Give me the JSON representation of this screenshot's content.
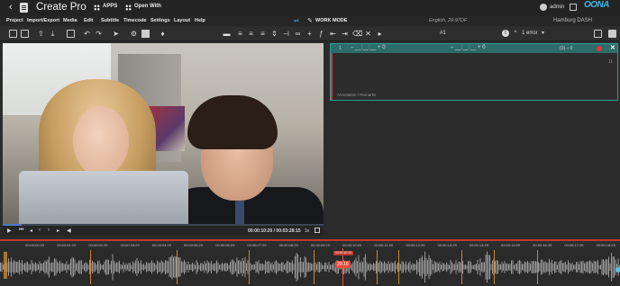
{
  "header": {
    "back_glyph": "‹",
    "title": "Create Pro",
    "apps_label": "APPS",
    "open_with_label": "Open With",
    "user_label": "admin",
    "logo": "OONA"
  },
  "menu": {
    "items": [
      "Project",
      "Import/Export",
      "Media",
      "Edit",
      "Subtitle",
      "Timecode",
      "Settings",
      "Layout",
      "Help"
    ],
    "work_mode": "WORK MODE",
    "language_info": "English, 29.97DF",
    "workspace": "Hamburg DASH"
  },
  "toolbar": {
    "cue_number": "#1",
    "error_label": "1 error",
    "error_dropdown": "▾"
  },
  "player": {
    "timecode": "00:00:10:20 / 00:03:28:15",
    "speed": "1x",
    "progress": 0.06
  },
  "subtitle_panel": {
    "index": "1",
    "in_time": "– __:__:__ + 0",
    "out_time": "– __:__:__ + 0",
    "char_count": "(0) – 0",
    "row_count": "11",
    "tags": "Annotation  /  Remarks"
  },
  "timeline": {
    "labels": [
      "00:00:00:29",
      "00:00:01:29",
      "00:00:02:29",
      "00:00:03:29",
      "00:00:04:29",
      "00:00:05:29",
      "00:00:06:29",
      "00:00:07:29",
      "00:00:08:29",
      "00:00:09:29",
      "00:00:10:29",
      "00:00:11:29",
      "00:00:12:29",
      "00:00:13:29",
      "00:00:14:29",
      "00:00:15:29",
      "00:00:16:29",
      "00:00:17:29",
      "00:00:18:29"
    ],
    "playhead_badge": "00:00:10:20",
    "playhead_value": "29.16"
  },
  "colors": {
    "accent": "#3fb6e8",
    "panel_border": "#2d9d9b",
    "playhead": "#e74c3c",
    "segment": "#c8892e"
  }
}
